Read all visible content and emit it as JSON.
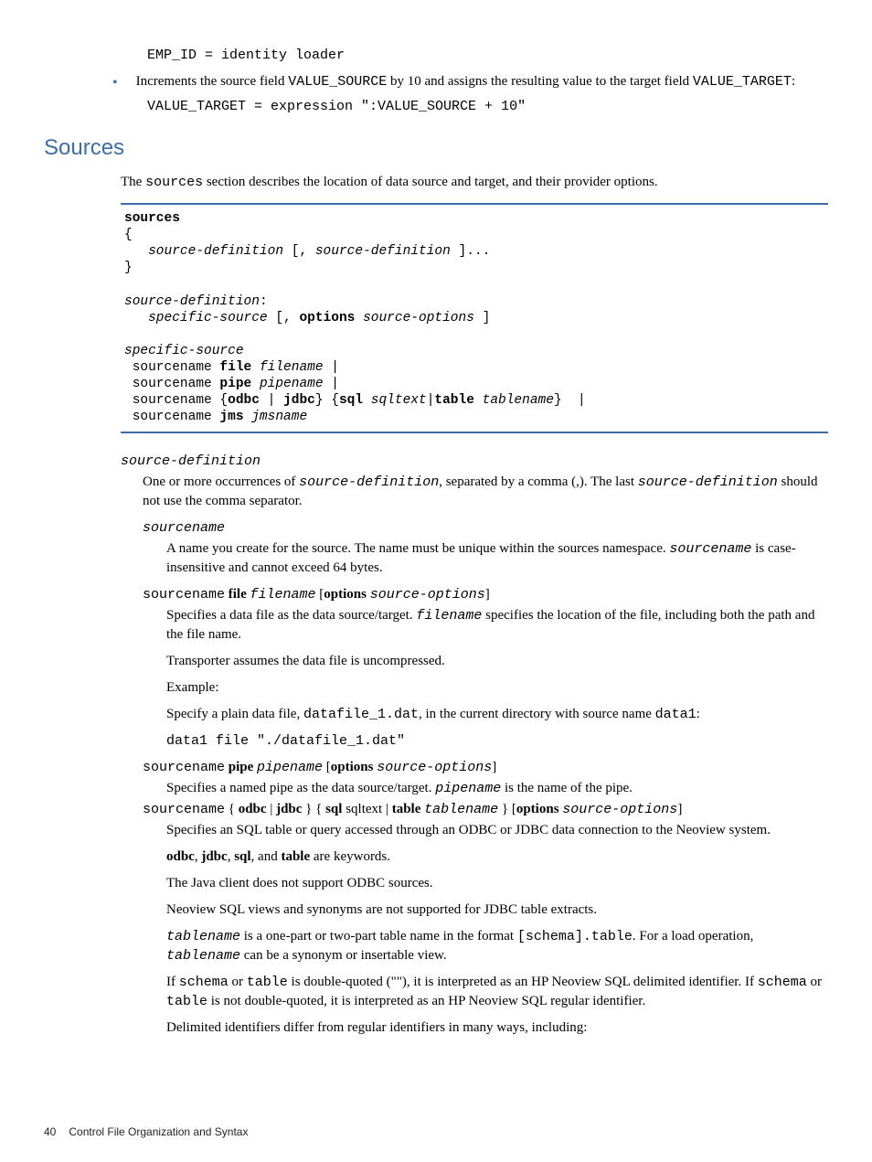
{
  "code_emp": "EMP_ID = identity loader",
  "bullet_text_a": "Increments the source field ",
  "bullet_code_a": "VALUE_SOURCE",
  "bullet_text_b": " by 10 and assigns the resulting value to the target field ",
  "bullet_code_b": "VALUE_TARGET",
  "bullet_text_c": ":",
  "code_value": "VALUE_TARGET = expression \":VALUE_SOURCE + 10\"",
  "heading": "Sources",
  "intro_a": "The ",
  "intro_code": "sources",
  "intro_b": " section describes the location of data source and target, and their provider options.",
  "term_sd": "source-definition",
  "sd_def_a": "One or more occurrences of ",
  "sd_def_code": "source-definition",
  "sd_def_b": ", separated by a comma (,). The last ",
  "sd_def_code2": "source-definition",
  "sd_def_c": " should not use the comma separator.",
  "term_sn": "sourcename",
  "sn_def_a": "A name you create for the source. The name must be unique within the sources namespace. ",
  "sn_def_code": "sourcename",
  "sn_def_b": " is case-insensitive and cannot exceed 64 bytes.",
  "term_file_a": "sourcename",
  "term_file_b": " file ",
  "term_file_c": "filename",
  "term_file_d": " [",
  "term_file_e": "options ",
  "term_file_f": "source-options",
  "term_file_g": "]",
  "file_def_a": "Specifies a data file as the data source/target. ",
  "file_def_code": "filename",
  "file_def_b": " specifies the location of the file, including both the path and the file name.",
  "file_def_p2": "Transporter assumes the data file is uncompressed.",
  "file_def_p3": "Example:",
  "file_def_p4a": "Specify a plain data file, ",
  "file_def_p4code": "datafile_1.dat",
  "file_def_p4b": ", in the current directory with source name ",
  "file_def_p4code2": "data1",
  "file_def_p4c": ":",
  "file_def_code_line": "data1 file \"./datafile_1.dat\"",
  "term_pipe_a": "sourcename",
  "term_pipe_b": " pipe ",
  "term_pipe_c": "pipename",
  "term_pipe_d": " [",
  "term_pipe_e": "options ",
  "term_pipe_f": "source-options",
  "term_pipe_g": "]",
  "pipe_def_a": "Specifies a named pipe as the data source/target. ",
  "pipe_def_code": "pipename",
  "pipe_def_b": " is the name of the pipe.",
  "term_odbc_a": "sourcename",
  "term_odbc_b": " { ",
  "term_odbc_c": "odbc",
  "term_odbc_d": " | ",
  "term_odbc_e": "jdbc",
  "term_odbc_f": " } { ",
  "term_odbc_g": "sql",
  "term_odbc_h": " sqltext | ",
  "term_odbc_i": "table ",
  "term_odbc_j": "tablename",
  "term_odbc_k": " } [",
  "term_odbc_l": "options ",
  "term_odbc_m": "source-options",
  "term_odbc_n": "]",
  "odbc_def_p1": "Specifies an SQL table or query accessed through an ODBC or JDBC data connection to the Neoview system.",
  "odbc_def_p2a": "odbc",
  "odbc_def_p2b": ", ",
  "odbc_def_p2c": "jdbc",
  "odbc_def_p2d": ", ",
  "odbc_def_p2e": "sql",
  "odbc_def_p2f": ", and ",
  "odbc_def_p2g": "table",
  "odbc_def_p2h": " are keywords.",
  "odbc_def_p3": "The Java client does not support ODBC sources.",
  "odbc_def_p4": "Neoview SQL views and synonyms are not supported for JDBC table extracts.",
  "odbc_def_p5a": "tablename",
  "odbc_def_p5b": " is a one-part or two-part table name in the format ",
  "odbc_def_p5c": "[schema].table",
  "odbc_def_p5d": ". For a load operation, ",
  "odbc_def_p5e": "tablename",
  "odbc_def_p5f": " can be a synonym or insertable view.",
  "odbc_def_p6a": "If ",
  "odbc_def_p6b": "schema",
  "odbc_def_p6c": " or ",
  "odbc_def_p6d": "table",
  "odbc_def_p6e": " is double-quoted (\"\"), it is interpreted as an HP Neoview SQL delimited identifier. If ",
  "odbc_def_p6f": "schema",
  "odbc_def_p6g": " or ",
  "odbc_def_p6h": "table",
  "odbc_def_p6i": " is not double-quoted, it is interpreted as an HP Neoview SQL regular identifier.",
  "odbc_def_p7": "Delimited identifiers differ from regular identifiers in many ways, including:",
  "footer_page": "40",
  "footer_title": "Control File Organization and Syntax",
  "syntax": {
    "l1a": "sources",
    "l2": "{",
    "l3a": "   ",
    "l3b": "source-definition",
    "l3c": " [, ",
    "l3d": "source-definition",
    "l3e": " ]...",
    "l4": "}",
    "l5a": "source-definition",
    "l5b": ":",
    "l6a": "   ",
    "l6b": "specific-source",
    "l6c": " [, ",
    "l6d": "options",
    "l6e": " ",
    "l6f": "source-options",
    "l6g": " ]",
    "l7": "specific-source",
    "l8a": " sourcename ",
    "l8b": "file",
    "l8c": " ",
    "l8d": "filename",
    "l8e": " |",
    "l9a": " sourcename ",
    "l9b": "pipe",
    "l9c": " ",
    "l9d": "pipename",
    "l9e": " |",
    "l10a": " sourcename {",
    "l10b": "odbc",
    "l10c": " | ",
    "l10d": "jdbc",
    "l10e": "} {",
    "l10f": "sql",
    "l10g": " ",
    "l10h": "sqltext",
    "l10i": "|",
    "l10j": "table",
    "l10k": " ",
    "l10l": "tablename",
    "l10m": "}  |",
    "l11a": " sourcename ",
    "l11b": "jms",
    "l11c": " ",
    "l11d": "jmsname"
  }
}
